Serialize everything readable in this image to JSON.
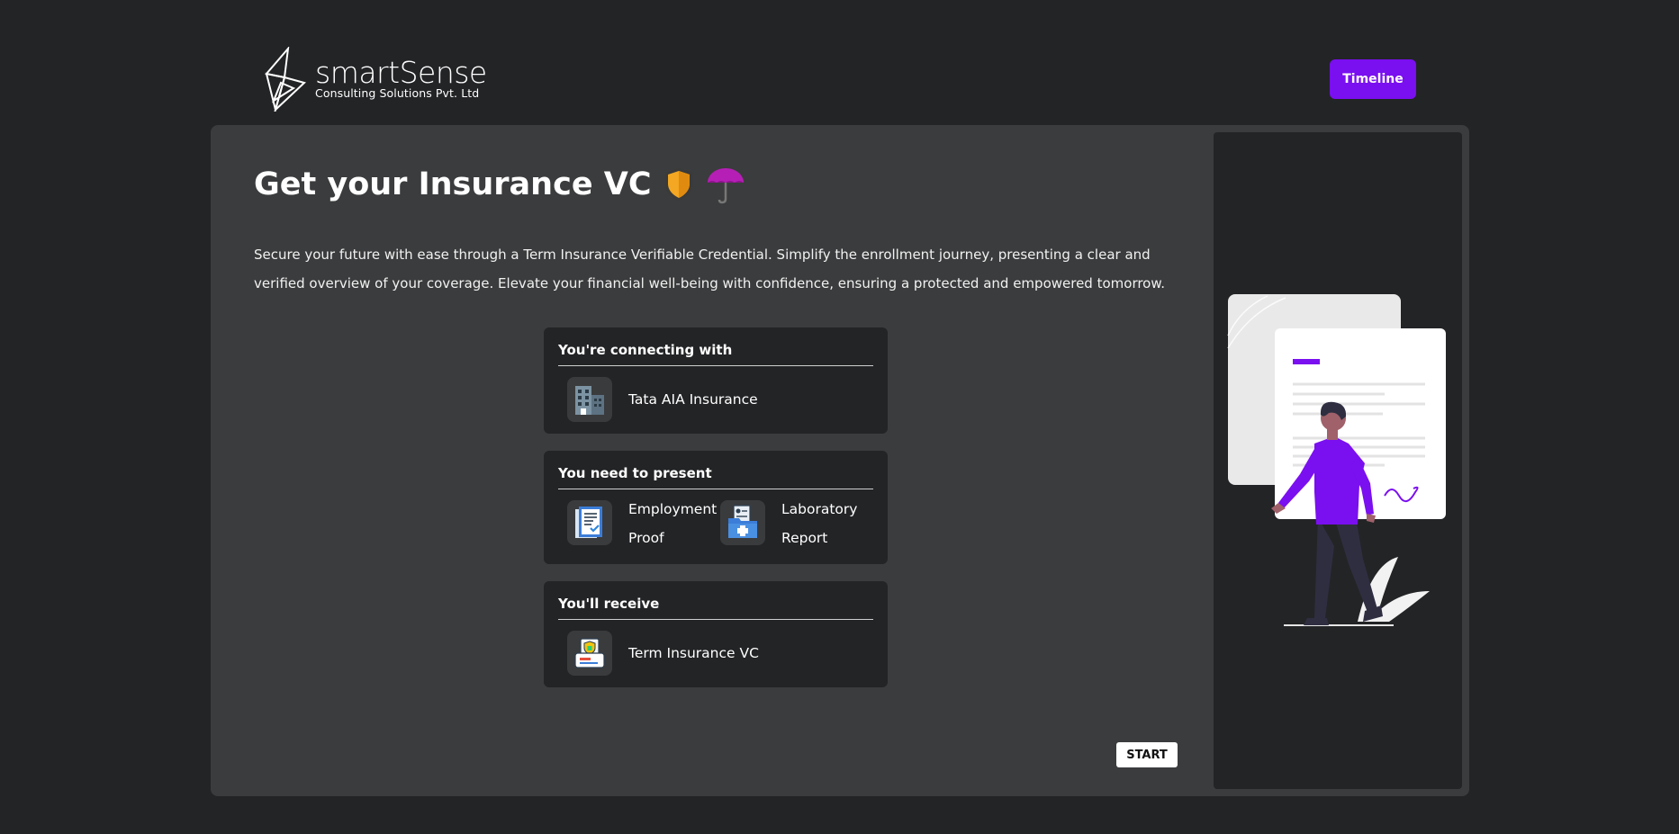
{
  "header": {
    "logo_name": "smartSense",
    "logo_subtitle": "Consulting Solutions Pvt. Ltd",
    "timeline_label": "Timeline"
  },
  "main": {
    "title": "Get your Insurance VC",
    "title_icons": [
      "shield-icon",
      "umbrella-icon"
    ],
    "description": "Secure your future with ease through a Term Insurance Verifiable Credential. Simplify the enrollment journey, presenting a clear and verified overview of your coverage. Elevate your financial well-being with confidence, ensuring a protected and empowered tomorrow.",
    "connecting": {
      "heading": "You're connecting with",
      "organization": "Tata AIA Insurance",
      "icon": "building-icon"
    },
    "present": {
      "heading": "You need to present",
      "items": [
        {
          "label": "Employment Proof",
          "icon": "document-check-icon"
        },
        {
          "label": "Laboratory Report",
          "icon": "medical-folder-icon"
        }
      ]
    },
    "receive": {
      "heading": "You'll receive",
      "item": "Term Insurance VC",
      "icon": "insurance-card-icon"
    },
    "start_label": "START"
  },
  "colors": {
    "background": "#232426",
    "card": "#3b3c3d",
    "accent": "#7a0ff0"
  }
}
